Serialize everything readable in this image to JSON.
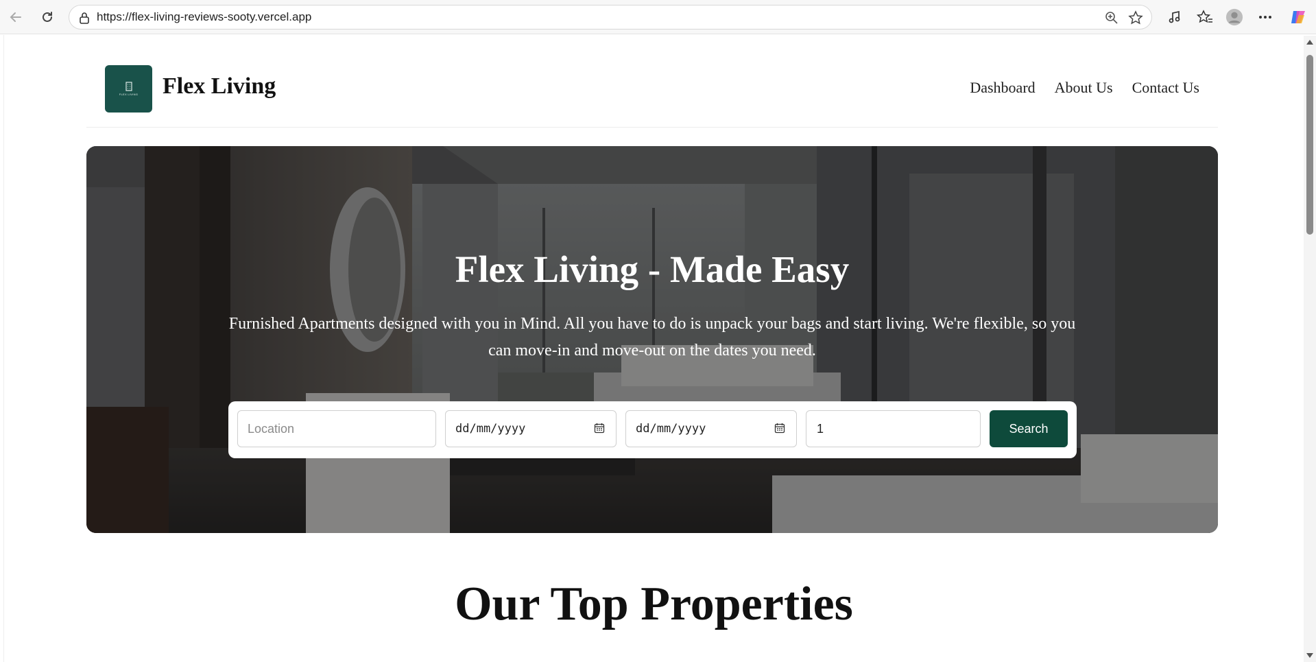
{
  "browser": {
    "url": "https://flex-living-reviews-sooty.vercel.app",
    "icons": [
      "back-icon",
      "reload-icon",
      "lock-icon",
      "zoom-icon",
      "favorite-star-icon",
      "media-icon",
      "favorites-icon",
      "profile-icon",
      "more-icon",
      "copilot-icon"
    ]
  },
  "header": {
    "brand": "Flex Living",
    "logo_text": "FLEX LIVING",
    "nav": [
      {
        "label": "Dashboard"
      },
      {
        "label": "About Us"
      },
      {
        "label": "Contact Us"
      }
    ]
  },
  "hero": {
    "title": "Flex Living - Made Easy",
    "subtitle": "Furnished Apartments designed with you in Mind. All you have to do is unpack your bags and start living. We're flexible, so you can move-in and move-out on the dates you need."
  },
  "search": {
    "location_placeholder": "Location",
    "checkin_placeholder": "dd/mm/yyyy",
    "checkout_placeholder": "dd/mm/yyyy",
    "guests_value": "1",
    "button_label": "Search"
  },
  "sections": {
    "top_properties_title": "Our Top Properties"
  },
  "colors": {
    "brand_green": "#0e4a3b",
    "logo_green": "#19524a"
  }
}
